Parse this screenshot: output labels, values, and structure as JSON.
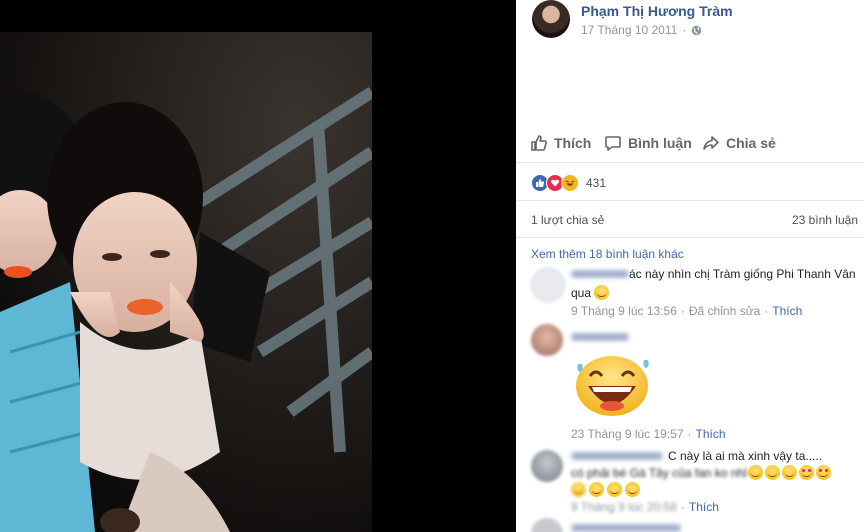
{
  "post": {
    "author": "Phạm Thị Hương Tràm",
    "date": "17 Tháng 10 2011",
    "separator": "·",
    "privacy_icon": "globe-icon"
  },
  "actions": {
    "like": "Thích",
    "comment": "Bình luận",
    "share": "Chia sẻ"
  },
  "reactions": {
    "icons": [
      "like-icon",
      "love-icon",
      "haha-icon"
    ],
    "colors": {
      "like": "#4267b2",
      "love": "#f0284a",
      "haha": "#f7b125"
    },
    "count": "431"
  },
  "stats": {
    "shares": "1 lượt chia sẻ",
    "comments": "23 bình luận"
  },
  "comments_section": {
    "more_comments": "Xem thêm 18 bình luận khác",
    "comments": [
      {
        "text_line1": "ác này nhìn chị Tràm giống Phi Thanh Vân",
        "text_line2": "qua",
        "time": "9 Tháng 9 lúc 13:56",
        "edited": "Đã chỉnh sửa",
        "like": "Thích",
        "dot": "·"
      },
      {
        "time": "23 Tháng 9 lúc 19:57",
        "like": "Thích",
        "dot": "·"
      },
      {
        "text_line1": "C này là ai mà xinh vậy ta.....",
        "text_line2": "có phải bé Gà Tây của fan ko nhỉ",
        "time": "9 Tháng 9 lúc 20:58",
        "like": "Thích",
        "dot": "·"
      }
    ]
  },
  "colors": {
    "link": "#365899",
    "action_link": "#4267b2",
    "muted": "#90949c"
  }
}
